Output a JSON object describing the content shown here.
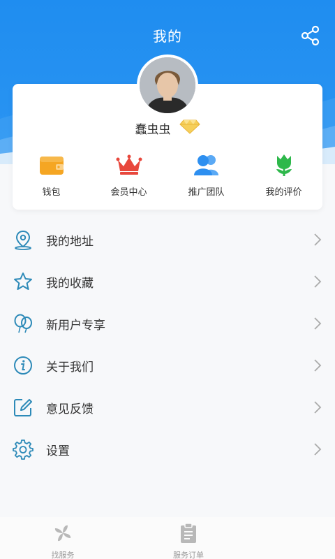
{
  "header": {
    "title": "我的",
    "share_icon": "share-icon",
    "bg_color": "#1f8df0"
  },
  "profile": {
    "avatar_icon": "avatar",
    "username": "蠢虫虫",
    "badge_icon": "diamond-icon",
    "badge_color": "#f4c34a"
  },
  "quick_actions": [
    {
      "label": "钱包",
      "icon": "wallet-icon",
      "color": "#f5a623"
    },
    {
      "label": "会员中心",
      "icon": "crown-icon",
      "color": "#e8473c"
    },
    {
      "label": "推广团队",
      "icon": "team-icon",
      "color": "#2d8ff0"
    },
    {
      "label": "我的评价",
      "icon": "tulip-icon",
      "color": "#2eb84b"
    }
  ],
  "menu": [
    {
      "label": "我的地址",
      "icon": "location-icon"
    },
    {
      "label": "我的收藏",
      "icon": "star-icon"
    },
    {
      "label": "新用户专享",
      "icon": "balloon-icon"
    },
    {
      "label": "关于我们",
      "icon": "info-icon"
    },
    {
      "label": "意见反馈",
      "icon": "edit-icon"
    },
    {
      "label": "设置",
      "icon": "gear-icon"
    }
  ],
  "tabbar": [
    {
      "label": "找服务",
      "icon": "pinwheel-icon"
    },
    {
      "label": "服务订单",
      "icon": "clipboard-icon"
    }
  ],
  "colors": {
    "menu_icon": "#2d8ab8",
    "tab_inactive": "#b8b8b8"
  }
}
